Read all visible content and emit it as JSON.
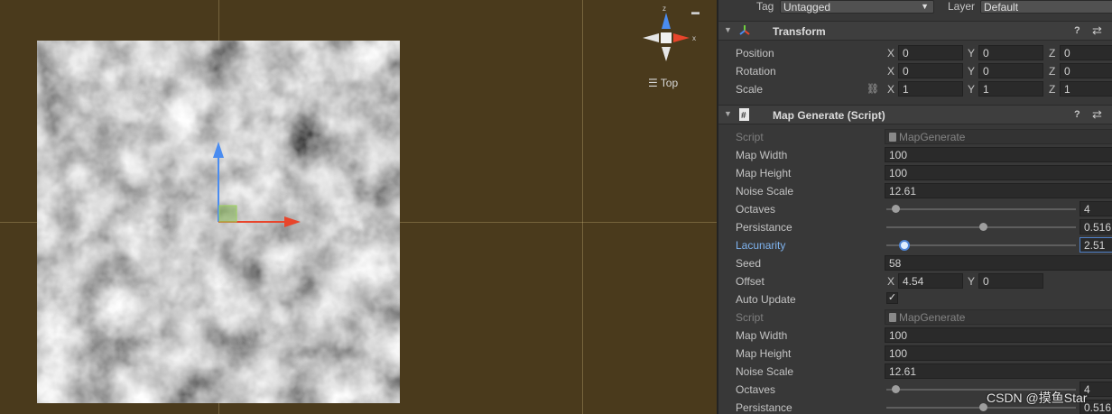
{
  "scene": {
    "view_label": "Top",
    "gizmo_axes": {
      "x": "x",
      "z": "z"
    }
  },
  "inspector": {
    "tag_label": "Tag",
    "tag_value": "Untagged",
    "layer_label": "Layer",
    "layer_value": "Default",
    "transform": {
      "title": "Transform",
      "position": {
        "label": "Position",
        "x": "0",
        "y": "0",
        "z": "0"
      },
      "rotation": {
        "label": "Rotation",
        "x": "0",
        "y": "0",
        "z": "0"
      },
      "scale": {
        "label": "Scale",
        "x": "1",
        "y": "1",
        "z": "1"
      },
      "axis_x": "X",
      "axis_y": "Y",
      "axis_z": "Z"
    },
    "map_generate": {
      "title": "Map Generate (Script)",
      "script_label": "Script",
      "script_value": "MapGenerate",
      "map_width_label": "Map Width",
      "map_width": "100",
      "map_height_label": "Map Height",
      "map_height": "100",
      "noise_scale_label": "Noise Scale",
      "noise_scale": "12.61",
      "octaves_label": "Octaves",
      "octaves": "4",
      "persistance_label": "Persistance",
      "persistance": "0.516",
      "lacunarity_label": "Lacunarity",
      "lacunarity": "2.51",
      "seed_label": "Seed",
      "seed": "58",
      "offset_label": "Offset",
      "offset_x": "4.54",
      "offset_y": "0",
      "auto_update_label": "Auto Update",
      "auto_update": true
    },
    "repeat": {
      "script_label": "Script",
      "script_value": "MapGenerate",
      "map_width_label": "Map Width",
      "map_width": "100",
      "map_height_label": "Map Height",
      "map_height": "100",
      "noise_scale_label": "Noise Scale",
      "noise_scale": "12.61",
      "octaves_label": "Octaves",
      "octaves": "4",
      "persistance_label": "Persistance",
      "persistance": "0.516"
    }
  },
  "watermark": "CSDN @摸鱼Star",
  "colors": {
    "scene_bg": "#4a3a1c",
    "x_axis": "#e8452b",
    "y_axis": "#4a8cf0",
    "z_axis": "#4a8cf0",
    "inspector_bg": "#383838"
  }
}
